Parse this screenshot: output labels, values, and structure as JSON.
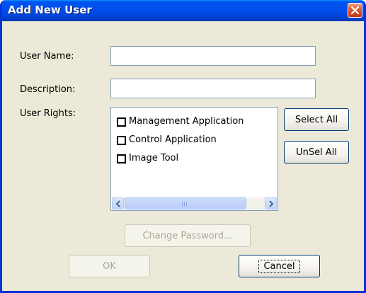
{
  "window": {
    "title": "Add New User"
  },
  "form": {
    "user_name_label": "User Name:",
    "user_name_value": "",
    "description_label": "Description:",
    "description_value": "",
    "user_rights_label": "User Rights:"
  },
  "rights_list": {
    "items": [
      {
        "label": "Management Application",
        "checked": false
      },
      {
        "label": "Control Application",
        "checked": false
      },
      {
        "label": "Image Tool",
        "checked": false
      }
    ]
  },
  "buttons": {
    "select_all": "Select All",
    "unselect_all": "UnSel All",
    "change_password": "Change Password...",
    "ok": "OK",
    "cancel": "Cancel"
  },
  "icons": {
    "close": "close-icon",
    "scroll_left": "chevron-left-icon",
    "scroll_right": "chevron-right-icon"
  },
  "colors": {
    "titlebar": "#0054e3",
    "window_border": "#0831d9",
    "dialog_bg": "#ece9d8",
    "close_button": "#d4451f"
  }
}
